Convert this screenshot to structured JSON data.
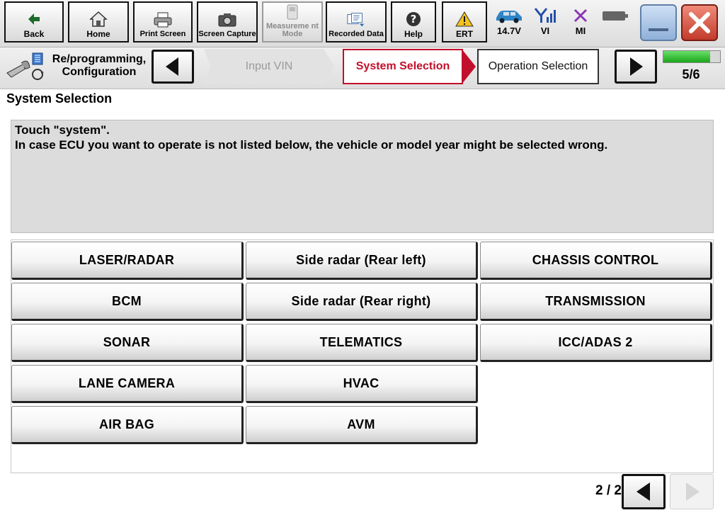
{
  "toolbar": {
    "back": "Back",
    "home": "Home",
    "print_screen": "Print Screen",
    "screen_capture": "Screen Capture",
    "measurement_mode": "Measureme nt Mode",
    "recorded_data": "Recorded Data",
    "help": "Help",
    "ert": "ERT",
    "voltage": "14.7V",
    "vi": "VI",
    "mi": "MI"
  },
  "breadcrumb": {
    "mode": "Re/programming, Configuration",
    "steps": [
      {
        "label": "Input VIN",
        "state": "inactive"
      },
      {
        "label": "System Selection",
        "state": "active"
      },
      {
        "label": "Operation Selection",
        "state": "next"
      }
    ],
    "progress": 0.83,
    "step_count": "5/6"
  },
  "page": {
    "title": "System Selection",
    "instruction_line1": "Touch \"system\".",
    "instruction_line2": "In case ECU you want to operate is not listed below, the vehicle or model year might be selected wrong."
  },
  "systems": {
    "col1": [
      "LASER/RADAR",
      "BCM",
      "SONAR",
      "LANE CAMERA",
      "AIR BAG"
    ],
    "col2": [
      "Side radar (Rear left)",
      "Side radar (Rear right)",
      "TELEMATICS",
      "HVAC",
      "AVM"
    ],
    "col3": [
      "CHASSIS CONTROL",
      "TRANSMISSION",
      "ICC/ADAS 2"
    ]
  },
  "pagination": {
    "page": "2 / 2"
  },
  "colors": {
    "active_step": "#c1102b",
    "progress": "#1aa61a"
  }
}
